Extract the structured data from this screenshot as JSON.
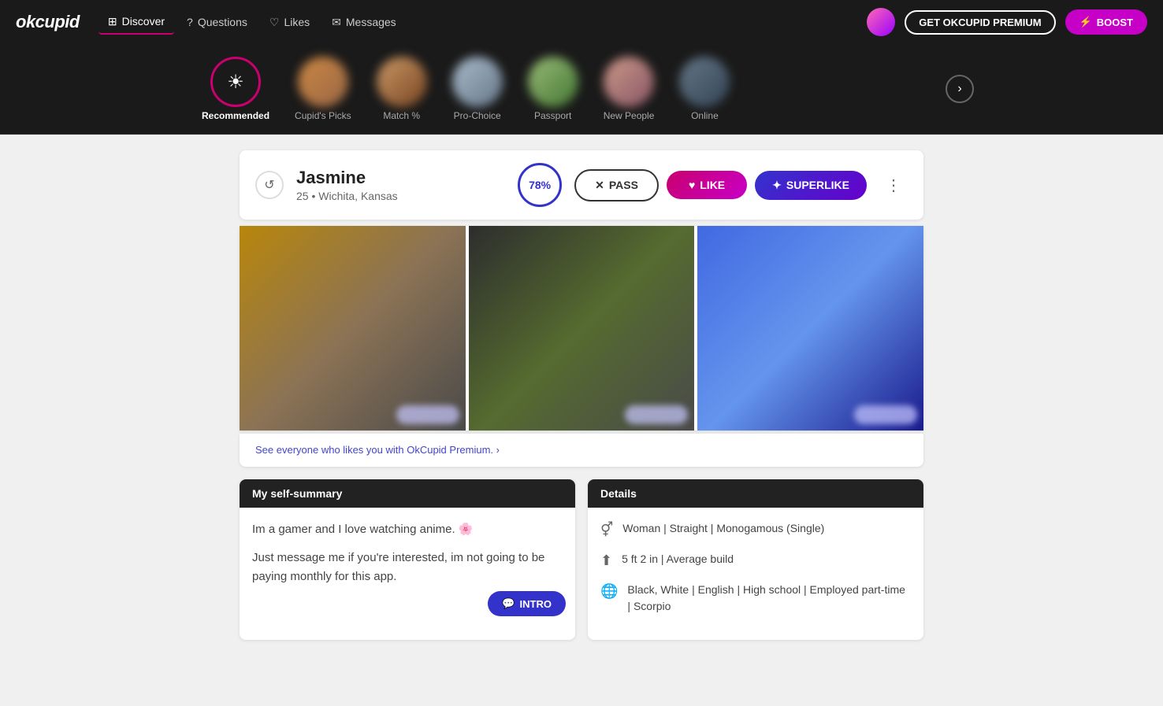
{
  "brand": {
    "logo": "okcupid"
  },
  "nav": {
    "items": [
      {
        "id": "discover",
        "label": "Discover",
        "icon": "grid-icon",
        "active": true
      },
      {
        "id": "questions",
        "label": "Questions",
        "icon": "question-icon",
        "active": false
      },
      {
        "id": "likes",
        "label": "Likes",
        "icon": "heart-icon",
        "active": false
      },
      {
        "id": "messages",
        "label": "Messages",
        "icon": "message-icon",
        "active": false
      }
    ],
    "premium_button": "GET OKCUPID PREMIUM",
    "boost_button": "BOOST"
  },
  "categories": [
    {
      "id": "recommended",
      "label": "Recommended",
      "active": true,
      "blurred": false
    },
    {
      "id": "cupids-picks",
      "label": "Cupid's Picks",
      "active": false,
      "blurred": true
    },
    {
      "id": "match",
      "label": "Match %",
      "active": false,
      "blurred": true
    },
    {
      "id": "pro-choice",
      "label": "Pro-Choice",
      "active": false,
      "blurred": true
    },
    {
      "id": "passport",
      "label": "Passport",
      "active": false,
      "blurred": true
    },
    {
      "id": "new-people",
      "label": "New People",
      "active": false,
      "blurred": true
    },
    {
      "id": "online",
      "label": "Online",
      "active": false,
      "blurred": true
    }
  ],
  "profile": {
    "name": "Jasmine",
    "age": "25",
    "location": "Wichita, Kansas",
    "match_percent": "78%",
    "pass_label": "PASS",
    "like_label": "LIKE",
    "superlike_label": "SUPERLIKE",
    "premium_link": "See everyone who likes you with OkCupid Premium. ›",
    "sections": {
      "summary": {
        "header": "My self-summary",
        "text1": "Im a gamer and I love watching anime. 🌸",
        "text2": "Just message me if you're interested, im not going to be paying monthly for this app.",
        "intro_button": "INTRO"
      },
      "details": {
        "header": "Details",
        "row1": "Woman | Straight | Monogamous (Single)",
        "row2": "5 ft 2 in | Average build",
        "row3": "Black, White | English | High school | Employed part-time | Scorpio"
      }
    }
  }
}
